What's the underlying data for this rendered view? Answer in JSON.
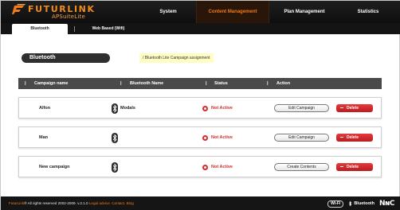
{
  "brand": {
    "name": "FUTURLINK",
    "product": "APSuiteLite",
    "accent": "#f07a1b"
  },
  "main_nav": [
    {
      "label": "System",
      "active": false
    },
    {
      "label": "Content Management",
      "active": true
    },
    {
      "label": "Plan Management",
      "active": false
    },
    {
      "label": "Statistics",
      "active": false
    }
  ],
  "sub_tabs": [
    {
      "label": "Bluetooth",
      "active": true
    },
    {
      "label": "Web Based (Wifi)",
      "active": false
    }
  ],
  "section": {
    "title": "Bluetooth",
    "hint": "/ Bluetooth Lite Campaign assignment"
  },
  "table": {
    "columns": [
      "Campaign name",
      "Bluetooth Name",
      "Status",
      "Action"
    ],
    "rows": [
      {
        "campaign": "Alfon",
        "bluetooth_name": "Modals",
        "status": "Not Active",
        "action_primary": "Edit Campaign",
        "action_delete": "Delete"
      },
      {
        "campaign": "Man",
        "bluetooth_name": "",
        "status": "Not Active",
        "action_primary": "Edit Campaign",
        "action_delete": "Delete"
      },
      {
        "campaign": "New campaign",
        "bluetooth_name": "",
        "status": "Not Active",
        "action_primary": "Create Contents",
        "action_delete": "Delete"
      }
    ],
    "status_color": "#d62a2a",
    "delete_color": "#d32a2d"
  },
  "footer": {
    "brand": "FuturLink",
    "reg": "®",
    "copyright": " All rights reserved 2002-2009. v.2.1.0",
    "links": "Legal advice. Contact. Blog",
    "badge_wifi": "Wi-Fi",
    "badge_bt": "Bluetooth",
    "badge_nfc": "NɴC"
  }
}
